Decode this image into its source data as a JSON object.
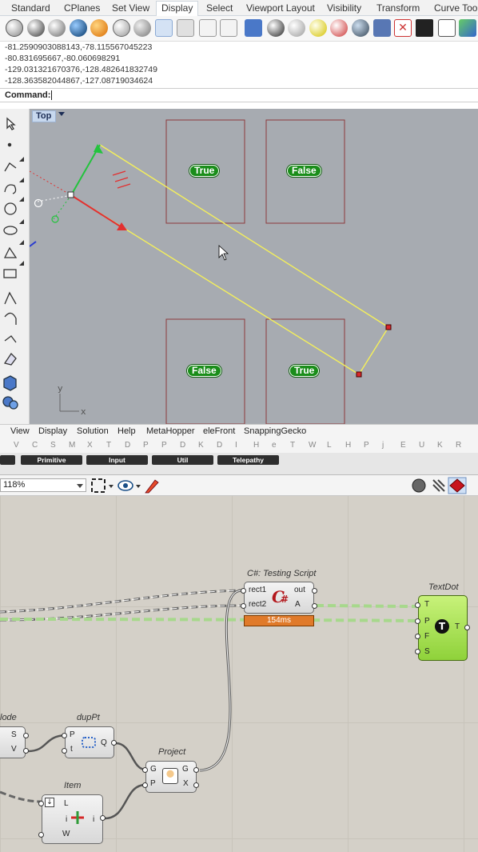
{
  "rhino": {
    "tabs": [
      "Standard",
      "CPlanes",
      "Set View",
      "Display",
      "Select",
      "Viewport Layout",
      "Visibility",
      "Transform",
      "Curve Tools"
    ],
    "active_tab": "Display",
    "history": [
      "-81.2590903088143,-78.115567045223",
      "-80.831695667,-80.060698291",
      "-129.031321670376,-128.482641832749",
      "-128.363582044867,-127.08719034624"
    ],
    "command_label": "Command:",
    "viewport_label": "Top",
    "axis_x": "x",
    "axis_y": "y",
    "dots": [
      "True",
      "False",
      "False",
      "True"
    ]
  },
  "grasshopper": {
    "menu": [
      "View",
      "Display",
      "Solution",
      "Help",
      "MetaHopper",
      "eleFront",
      "SnappingGecko"
    ],
    "tab_letters": [
      "V",
      "C",
      "S",
      "M",
      "X",
      "T",
      "D",
      "P",
      "P",
      "D",
      "K",
      "D",
      "I",
      "H",
      "e",
      "T",
      "W",
      "L",
      "H",
      "P",
      "j",
      "E",
      "U",
      "K",
      "R"
    ],
    "panels": [
      "Primitive",
      "Input",
      "Util",
      "Telepathy"
    ],
    "zoom": "118%",
    "components": {
      "script": {
        "title": "C#: Testing Script",
        "in1": "rect1",
        "in2": "rect2",
        "out1": "out",
        "out2": "A",
        "timer": "154ms"
      },
      "textdot": {
        "title": "TextDot",
        "p1": "T",
        "p2": "P",
        "p3": "F",
        "p4": "S",
        "out": "T"
      },
      "node": {
        "title": "lode",
        "p1": "S",
        "p2": "V"
      },
      "duppt": {
        "title": "dupPt",
        "p1": "P",
        "p2": "t",
        "out": "Q"
      },
      "project": {
        "title": "Project",
        "in1": "G",
        "in2": "P",
        "out1": "G",
        "out2": "X"
      },
      "item": {
        "title": "Item",
        "p1": "L",
        "p2": "i",
        "p3": "W",
        "out": "i"
      }
    }
  },
  "colors": {
    "viewport_bg": "#a7abb1",
    "rect_outline": "#8c3a3a",
    "selection_line": "#f5f05a",
    "dot_green": "#1a8d1a",
    "canvas_bg": "#d4d0c8",
    "wire_green": "#a7d88c",
    "timer_orange": "#e07a2a"
  }
}
